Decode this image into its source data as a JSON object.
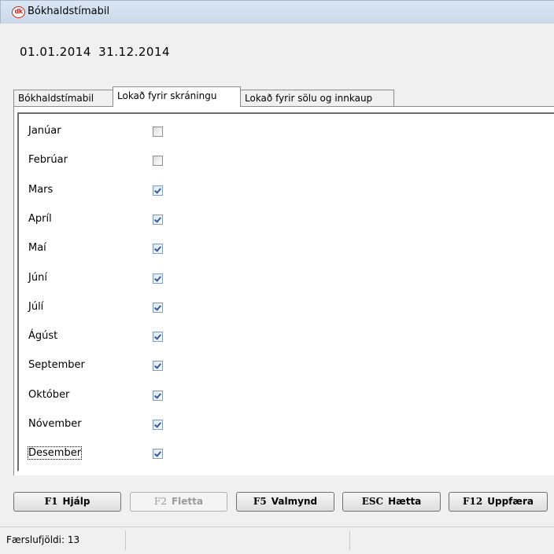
{
  "window": {
    "title": "Bókhaldstímabil",
    "logo_text": "dk"
  },
  "period": {
    "from": "01.01.2014",
    "to": "31.12.2014"
  },
  "tabs": [
    {
      "label": "Bókhaldstímabil",
      "active": false
    },
    {
      "label": "Lokað fyrir skráningu",
      "active": true
    },
    {
      "label": "Lokað fyrir sölu og innkaup",
      "active": false
    }
  ],
  "months": [
    {
      "label": "Janúar",
      "checked": false
    },
    {
      "label": "Febrúar",
      "checked": false
    },
    {
      "label": "Mars",
      "checked": true
    },
    {
      "label": "Apríl",
      "checked": true
    },
    {
      "label": "Maí",
      "checked": true
    },
    {
      "label": "Júní",
      "checked": true
    },
    {
      "label": "Júlí",
      "checked": true
    },
    {
      "label": "Ágúst",
      "checked": true
    },
    {
      "label": "September",
      "checked": true
    },
    {
      "label": "Október",
      "checked": true
    },
    {
      "label": "Nóvember",
      "checked": true
    },
    {
      "label": "Desember",
      "checked": true
    }
  ],
  "buttons": [
    {
      "key": "F1",
      "label": "Hjálp",
      "enabled": true
    },
    {
      "key": "F2",
      "label": "Fletta",
      "enabled": false
    },
    {
      "key": "F5",
      "label": "Valmynd",
      "enabled": true
    },
    {
      "key": "ESC",
      "label": "Hætta",
      "enabled": true
    },
    {
      "key": "F12",
      "label": "Uppfæra",
      "enabled": true
    }
  ],
  "status": {
    "record_count": "Færslufjöldi: 13"
  }
}
